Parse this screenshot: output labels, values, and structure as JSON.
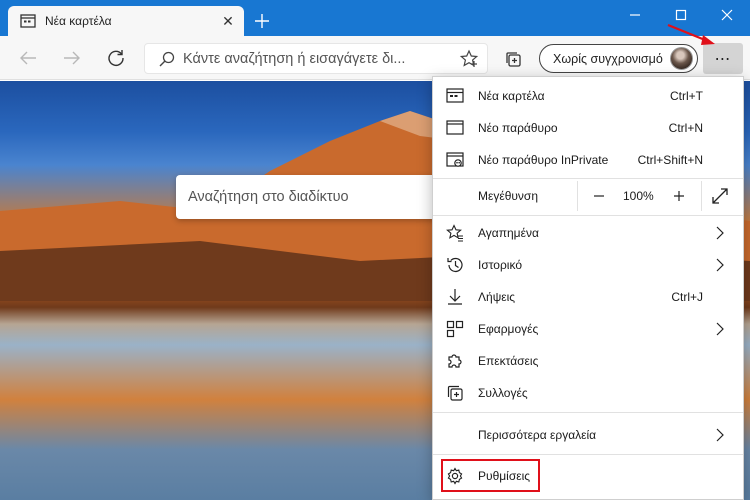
{
  "tab": {
    "title": "Νέα καρτέλα",
    "close_glyph": "✕"
  },
  "toolbar": {
    "address_placeholder": "Κάντε αναζήτηση ή εισαγάγετε δι...",
    "profile_label": "Χωρίς συγχρονισμό",
    "more_glyph": "⋯"
  },
  "window": {
    "minimize": "–",
    "maximize": "☐",
    "close": "✕"
  },
  "page": {
    "search_placeholder": "Αναζήτηση στο διαδίκτυο"
  },
  "menu": {
    "items": [
      {
        "label": "Νέα καρτέλα",
        "shortcut": "Ctrl+T",
        "icon": "new-tab-icon"
      },
      {
        "label": "Νέο παράθυρο",
        "shortcut": "Ctrl+N",
        "icon": "new-window-icon"
      },
      {
        "label": "Νέο παράθυρο InPrivate",
        "shortcut": "Ctrl+Shift+N",
        "icon": "inprivate-icon"
      },
      {
        "label": "Αγαπημένα",
        "shortcut": "",
        "icon": "favorites-icon"
      },
      {
        "label": "Ιστορικό",
        "shortcut": "",
        "icon": "history-icon"
      },
      {
        "label": "Λήψεις",
        "shortcut": "Ctrl+J",
        "icon": "download-icon"
      },
      {
        "label": "Εφαρμογές",
        "shortcut": "",
        "icon": "apps-icon"
      },
      {
        "label": "Επεκτάσεις",
        "shortcut": "",
        "icon": "extensions-icon"
      },
      {
        "label": "Συλλογές",
        "shortcut": "",
        "icon": "collections-icon"
      },
      {
        "label": "Περισσότερα εργαλεία",
        "shortcut": ""
      },
      {
        "label": "Ρυθμίσεις",
        "shortcut": "",
        "icon": "settings-icon"
      }
    ],
    "zoom": {
      "label": "Μεγέθυνση",
      "value": "100%",
      "minus": "—",
      "plus": "+"
    }
  },
  "colors": {
    "accent": "#1877d2",
    "highlight": "#e0101a"
  }
}
